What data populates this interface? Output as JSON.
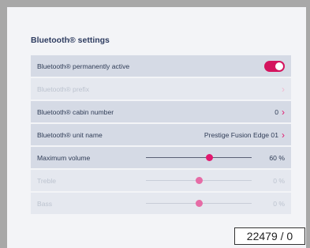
{
  "settings": {
    "title": "Bluetooth® settings",
    "rows": [
      {
        "label": "Bluetooth® permanently active",
        "value": "",
        "control": "toggle",
        "on": true
      },
      {
        "label": "Bluetooth® prefix",
        "value": "",
        "control": "chevron",
        "enabled": false
      },
      {
        "label": "Bluetooth® cabin number",
        "value": "0",
        "control": "chevron"
      },
      {
        "label": "Bluetooth® unit name",
        "value": "Prestige Fusion Edge 01",
        "control": "chevron"
      },
      {
        "label": "Maximum volume",
        "value": "60 %",
        "control": "slider",
        "level": 0.6
      },
      {
        "label": "Treble",
        "value": "0 %",
        "control": "slider",
        "level": 0.5,
        "enabled": false
      },
      {
        "label": "Bass",
        "value": "0 %",
        "control": "slider",
        "level": 0.5,
        "enabled": false
      }
    ]
  },
  "caption": "22479 / 0",
  "colors": {
    "accent": "#e2186f",
    "title": "#2e3c60"
  },
  "icons": {
    "chevron": "chevron-right-icon"
  }
}
